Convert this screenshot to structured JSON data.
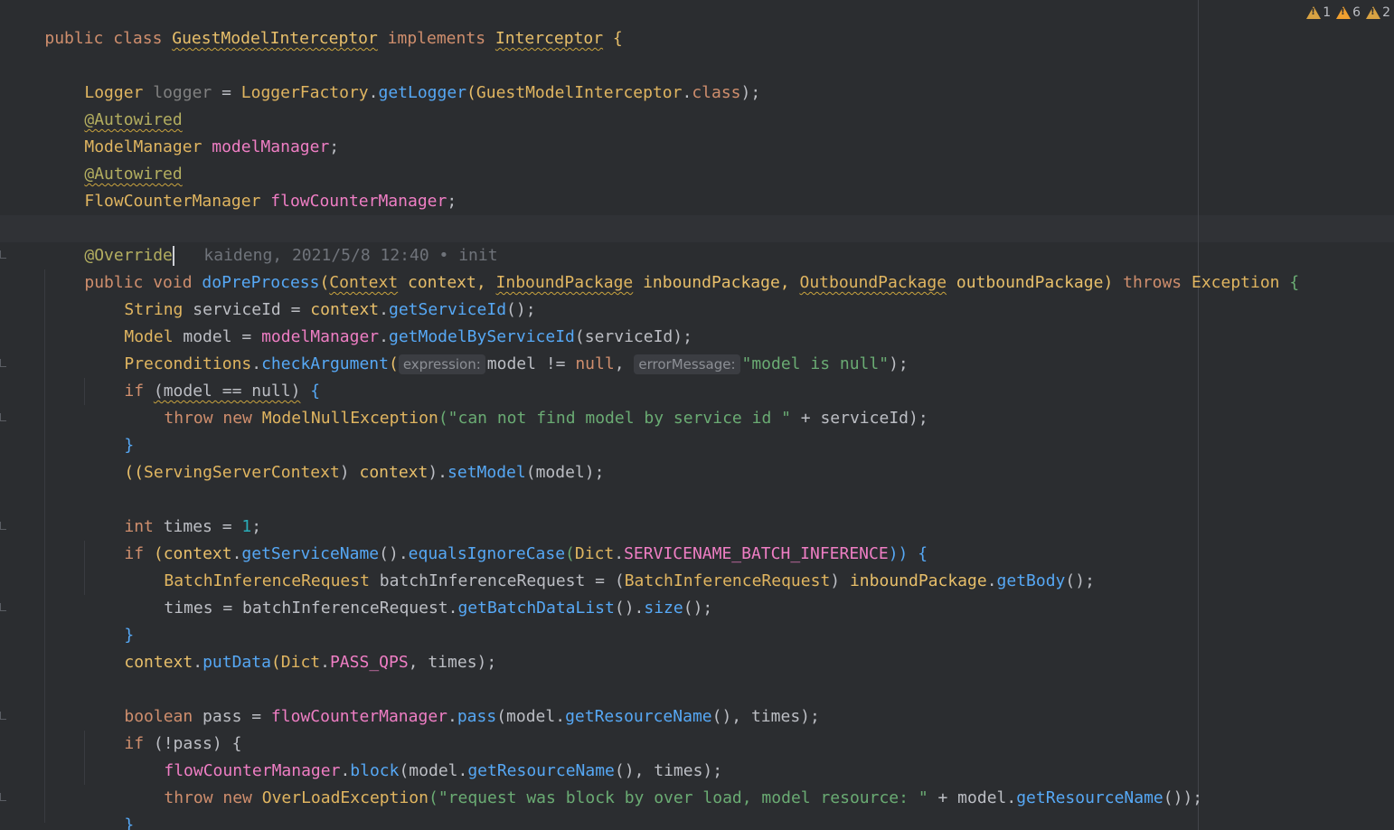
{
  "inspections": {
    "weak_warnings": "1",
    "warnings": "6",
    "typos": "2"
  },
  "blame": {
    "author": "kaideng,",
    "date": "2021/5/8 12:40",
    "separator": "•",
    "message": "init"
  },
  "hints": {
    "expression": "expression:",
    "error_message": "errorMessage:"
  },
  "code": {
    "l1_public_class": "public class ",
    "l1_class_name": "GuestModelInterceptor",
    "l1_implements": " implements ",
    "l1_iface": "Interceptor",
    "l1_brace": " {",
    "l3_type": "Logger",
    "l3_var": " logger",
    "l3_eq": " = ",
    "l3_factory": "LoggerFactory",
    "l3_dot": ".",
    "l3_method": "getLogger",
    "l3_paren": "(",
    "l3_arg": "GuestModelInterceptor",
    "l3_dot2": ".",
    "l3_class_kw": "class",
    "l3_end": ");",
    "l4_ann": "@Autowired",
    "l5_type": "ModelManager ",
    "l5_field": "modelManager",
    "l5_end": ";",
    "l6_ann": "@Autowired",
    "l7_type": "FlowCounterManager ",
    "l7_field": "flowCounterManager",
    "l7_end": ";",
    "l9_ann": "@Override",
    "l10_public_void": "public void ",
    "l10_method": "doPreProcess",
    "l10_p1": "(",
    "l10_t1": "Context",
    "l10_n1": " context, ",
    "l10_t2": "InboundPackage",
    "l10_n2": " inboundPackage, ",
    "l10_t3": "OutboundPackage",
    "l10_n3": " outboundPackage) ",
    "l10_throws": "throws ",
    "l10_exc": "Exception",
    "l10_brace": " {",
    "l11_type": "String",
    "l11_rest": " serviceId = ",
    "l11_ctx": "context",
    "l11_dot": ".",
    "l11_method": "getServiceId",
    "l11_end": "();",
    "l12_type": "Model",
    "l12_rest": " model = ",
    "l12_field": "modelManager",
    "l12_dot": ".",
    "l12_method": "getModelByServiceId",
    "l12_end": "(serviceId);",
    "l13_cls": "Preconditions",
    "l13_dot": ".",
    "l13_method": "checkArgument",
    "l13_paren": "(",
    "l13_arg1": "model != ",
    "l13_null": "null",
    "l13_comma": ", ",
    "l13_str": "\"model is null\"",
    "l13_end": ");",
    "l14_if": "if ",
    "l14_cond": "(model == null)",
    "l14_brace": " {",
    "l15_throw_new": "throw new ",
    "l15_cls": "ModelNullException",
    "l15_paren": "(",
    "l15_str": "\"can not find model by service id \"",
    "l15_rest": " + serviceId);",
    "l16_brace": "}",
    "l17_open": "((",
    "l17_cls": "ServingServerContext",
    "l17_mid": ") ",
    "l17_ctx": "context",
    "l17_dot": ").",
    "l17_method": "setModel",
    "l17_end": "(model);",
    "l19_int": "int",
    "l19_rest": " times = ",
    "l19_num": "1",
    "l19_end": ";",
    "l20_if": "if ",
    "l20_p": "(",
    "l20_ctx": "context",
    "l20_dot": ".",
    "l20_m1": "getServiceName",
    "l20_p2": "().",
    "l20_m2": "equalsIgnoreCase",
    "l20_p3": "(",
    "l20_dict": "Dict",
    "l20_dot2": ".",
    "l20_const": "SERVICENAME_BATCH_INFERENCE",
    "l20_end": ")) {",
    "l21_cls": "BatchInferenceRequest",
    "l21_rest": " batchInferenceRequest = (",
    "l21_cls2": "BatchInferenceRequest",
    "l21_mid": ") ",
    "l21_var": "inboundPackage",
    "l21_dot": ".",
    "l21_method": "getBody",
    "l21_end": "();",
    "l22_start": "times = batchInferenceRequest.",
    "l22_m1": "getBatchDataList",
    "l22_p": "().",
    "l22_m2": "size",
    "l22_end": "();",
    "l23_brace": "}",
    "l24_ctx": "context",
    "l24_dot": ".",
    "l24_method": "putData",
    "l24_p": "(",
    "l24_dict": "Dict",
    "l24_dot2": ".",
    "l24_const": "PASS_QPS",
    "l24_end": ", times);",
    "l26_bool": "boolean",
    "l26_rest": " pass = ",
    "l26_field": "flowCounterManager",
    "l26_dot": ".",
    "l26_method": "pass",
    "l26_p": "(model.",
    "l26_m2": "getResourceName",
    "l26_end": "(), times);",
    "l27_if": "if ",
    "l27_cond": "(!pass) {",
    "l28_field": "flowCounterManager",
    "l28_dot": ".",
    "l28_method": "block",
    "l28_p": "(model.",
    "l28_m2": "getResourceName",
    "l28_end": "(), times);",
    "l29_throw_new": "throw new ",
    "l29_cls": "OverLoadException",
    "l29_p": "(",
    "l29_str": "\"request was block by over load, model resource: \"",
    "l29_rest": " + model.",
    "l29_method": "getResourceName",
    "l29_end": "());",
    "l30_brace": "}",
    "l31_brace": "}"
  }
}
